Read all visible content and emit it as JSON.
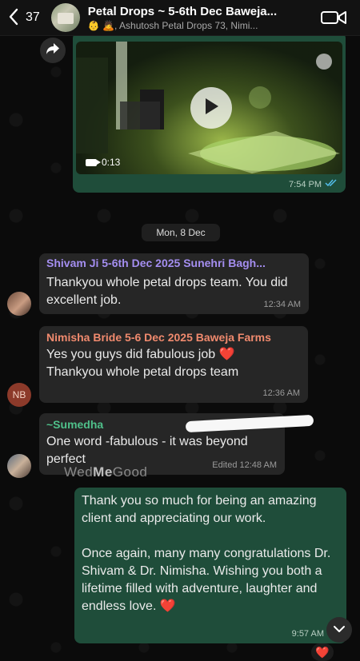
{
  "header": {
    "back_count": "37",
    "title": "Petal Drops ~ 5-6th Dec Baweja...",
    "subtitle": "👶 🙇, Ashutosh Petal Drops 73, Nimi..."
  },
  "video_message": {
    "duration": "0:13",
    "time": "7:54 PM"
  },
  "date_divider": "Mon, 8 Dec",
  "messages": [
    {
      "sender": "Shivam Ji 5-6th Dec 2025 Sunehri Bagh...",
      "text": "Thankyou whole petal drops team. You did excellent job.",
      "time": "12:34 AM"
    },
    {
      "avatar_initials": "NB",
      "sender": "Nimisha Bride 5-6 Dec 2025 Baweja Farms",
      "text_line1": "Yes you guys did fabulous job ❤️",
      "text_line2": "Thankyou whole petal drops team",
      "time": "12:36 AM"
    },
    {
      "sender": "~Sumedha",
      "text": "One word -fabulous - it was beyond perfect",
      "time": "Edited  12:48 AM"
    }
  ],
  "watermark": {
    "part1": "Wed",
    "part2": "Me",
    "part3": "Good"
  },
  "outgoing": {
    "para1": "Thank you so much for being an amazing client and appreciating our work.",
    "para2": "Once again, many many congratulations Dr. Shivam & Dr. Nimisha. Wishing you both a lifetime filled with adventure, laughter and endless love. ❤️",
    "time": "9:57 AM",
    "reaction": "❤️"
  },
  "colors": {
    "outgoing_bubble": "#1f4d3a",
    "incoming_bubble": "#262626",
    "sender1": "#a48ef0",
    "sender2": "#f08a6e",
    "sender3": "#4fc08a",
    "read_ticks": "#53bdeb"
  },
  "icons": [
    "chevron-left-icon",
    "video-camera-icon",
    "forward-icon",
    "play-icon",
    "double-check-icon",
    "chevron-down-icon"
  ]
}
